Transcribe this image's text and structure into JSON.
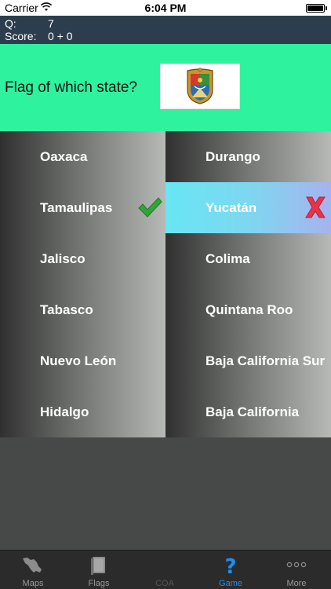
{
  "status_bar": {
    "carrier": "Carrier",
    "time": "6:04 PM",
    "wifi_icon": "wifi-icon",
    "battery_icon": "battery-icon"
  },
  "score": {
    "q_label": "Q:",
    "q_value": "7",
    "score_label": "Score:",
    "score_value": "0 + 0"
  },
  "question": {
    "text": "Flag of which state?",
    "flag_icon": "tamaulipas-flag"
  },
  "answers": [
    {
      "label": "Oaxaca",
      "state": "normal"
    },
    {
      "label": "Durango",
      "state": "normal"
    },
    {
      "label": "Tamaulipas",
      "state": "correct"
    },
    {
      "label": "Yucatán",
      "state": "wrong"
    },
    {
      "label": "Jalisco",
      "state": "normal"
    },
    {
      "label": "Colima",
      "state": "normal"
    },
    {
      "label": "Tabasco",
      "state": "normal"
    },
    {
      "label": "Quintana Roo",
      "state": "normal"
    },
    {
      "label": "Nuevo León",
      "state": "normal"
    },
    {
      "label": "Baja California Sur",
      "state": "normal"
    },
    {
      "label": "Hidalgo",
      "state": "normal"
    },
    {
      "label": "Baja California",
      "state": "normal"
    }
  ],
  "tabs": [
    {
      "label": "Maps",
      "icon": "map-icon",
      "state": "normal"
    },
    {
      "label": "Flags",
      "icon": "flag-book-icon",
      "state": "normal"
    },
    {
      "label": "COA",
      "icon": "coat-of-arms-icon",
      "state": "disabled"
    },
    {
      "label": "Game",
      "icon": "question-mark-icon",
      "state": "active"
    },
    {
      "label": "More",
      "icon": "more-icon",
      "state": "normal"
    }
  ],
  "colors": {
    "question_bg": "#2ef29e",
    "score_bg": "#2c3d4e",
    "active_tab": "#1f8ef1",
    "correct": "#33aa33",
    "wrong": "#e8334a"
  }
}
